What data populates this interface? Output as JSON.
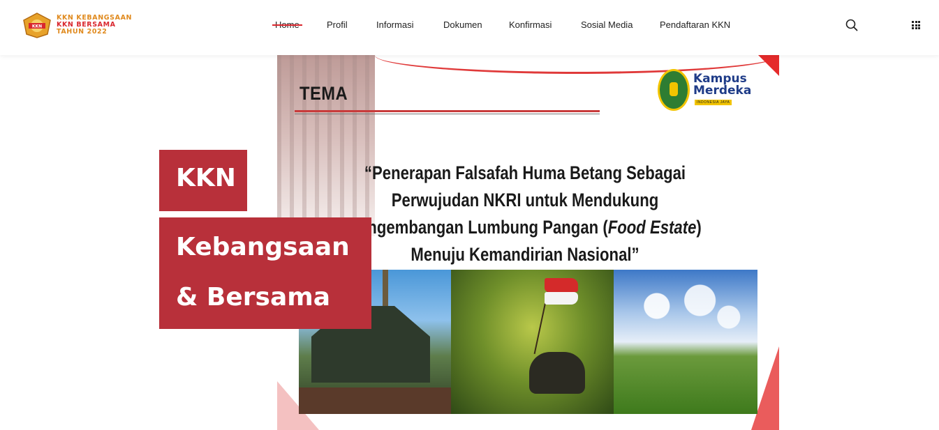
{
  "brand": {
    "line1": "KKN KEBANGSAAN",
    "line2": "KKN BERSAMA",
    "line3": "TAHUN 2022",
    "badge_text": "KKN"
  },
  "nav": {
    "items": [
      {
        "label": "Home",
        "active": true
      },
      {
        "label": "Profil"
      },
      {
        "label": "Informasi"
      },
      {
        "label": "Dokumen"
      },
      {
        "label": "Konfirmasi"
      },
      {
        "label": "Sosial Media"
      },
      {
        "label": "Pendaftaran KKN"
      }
    ]
  },
  "header_icons": [
    "search-icon",
    "apps-grid-icon"
  ],
  "hero": {
    "box1": "KKN",
    "box2_line1": "Kebangsaan",
    "box2_line2": "& Bersama"
  },
  "banner": {
    "heading": "TEMA",
    "logo_text_1": "Kampus",
    "logo_text_2": "Merdeka",
    "logo_sub": "INDONESIA JAYA",
    "quote_part1": "“Penerapan Falsafah Huma Betang Sebagai Perwujudan NKRI untuk Mendukung Pengembangan Lumbung Pangan (",
    "quote_italic1": "Food Estate",
    "quote_part2": ") Menuju Kemandirian Nasional”"
  },
  "colors": {
    "accent_red": "#b8303a",
    "brand_orange": "#e08a1e",
    "brand_red": "#d9272e"
  }
}
